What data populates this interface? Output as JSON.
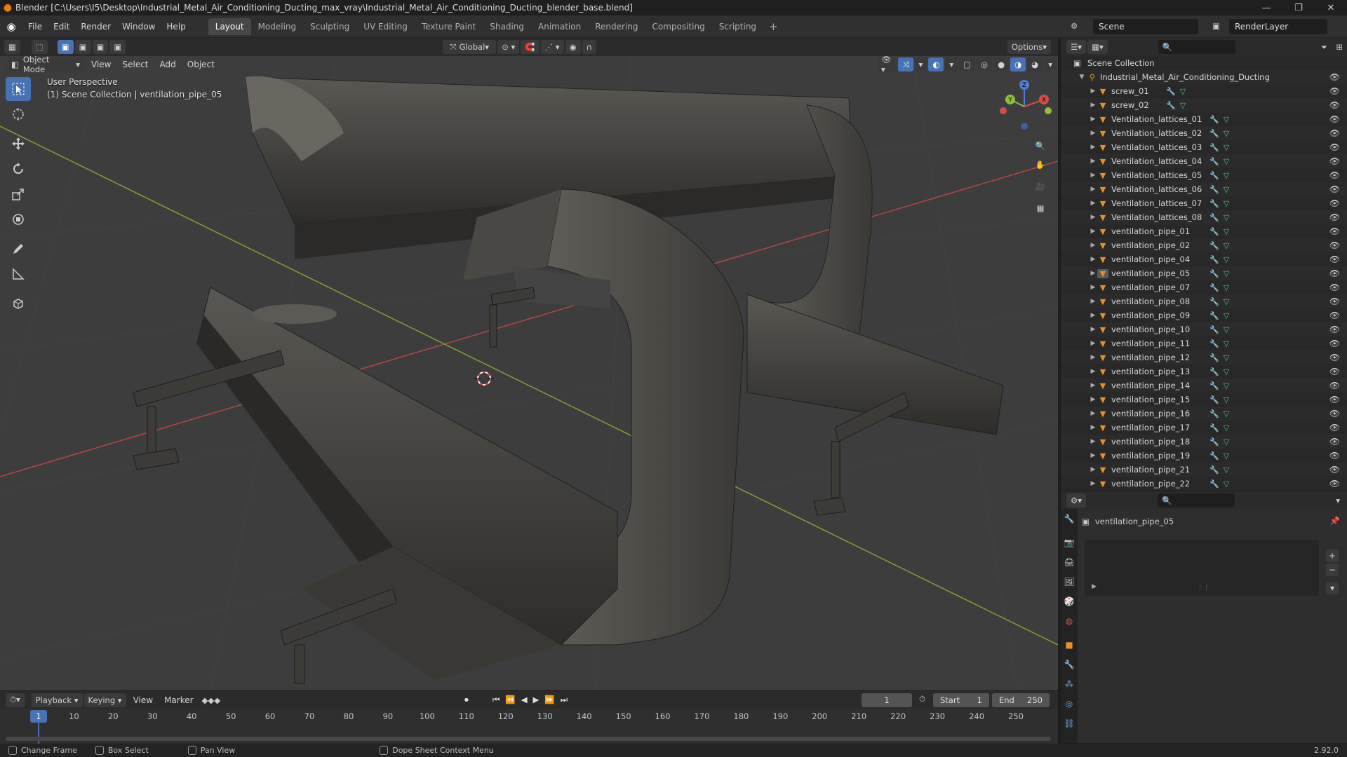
{
  "window": {
    "title": "Blender [C:\\Users\\I5\\Desktop\\Industrial_Metal_Air_Conditioning_Ducting_max_vray\\Industrial_Metal_Air_Conditioning_Ducting_blender_base.blend]"
  },
  "menubar": {
    "menus": [
      "File",
      "Edit",
      "Render",
      "Window",
      "Help"
    ],
    "workspaces": [
      "Layout",
      "Modeling",
      "Sculpting",
      "UV Editing",
      "Texture Paint",
      "Shading",
      "Animation",
      "Rendering",
      "Compositing",
      "Scripting"
    ],
    "active_workspace": "Layout",
    "scene": "Scene",
    "view_layer": "RenderLayer"
  },
  "viewport": {
    "mode": "Object Mode",
    "menus": [
      "View",
      "Select",
      "Add",
      "Object"
    ],
    "orientation": "Global",
    "options": "Options",
    "perspective_label": "User Perspective",
    "collection_label": "(1) Scene Collection | ventilation_pipe_05"
  },
  "outliner": {
    "root": "Scene Collection",
    "collection": "Industrial_Metal_Air_Conditioning_Ducting",
    "objects": [
      "screw_01",
      "screw_02",
      "Ventilation_lattices_01",
      "Ventilation_lattices_02",
      "Ventilation_lattices_03",
      "Ventilation_lattices_04",
      "Ventilation_lattices_05",
      "Ventilation_lattices_06",
      "Ventilation_lattices_07",
      "Ventilation_lattices_08",
      "ventilation_pipe_01",
      "ventilation_pipe_02",
      "ventilation_pipe_04",
      "ventilation_pipe_05",
      "ventilation_pipe_07",
      "ventilation_pipe_08",
      "ventilation_pipe_09",
      "ventilation_pipe_10",
      "ventilation_pipe_11",
      "ventilation_pipe_12",
      "ventilation_pipe_13",
      "ventilation_pipe_14",
      "ventilation_pipe_15",
      "ventilation_pipe_16",
      "ventilation_pipe_17",
      "ventilation_pipe_18",
      "ventilation_pipe_19",
      "ventilation_pipe_21",
      "ventilation_pipe_22"
    ],
    "selected": "ventilation_pipe_05"
  },
  "properties": {
    "object_name": "ventilation_pipe_05"
  },
  "timeline": {
    "menus": [
      "Playback",
      "Keying",
      "View",
      "Marker"
    ],
    "current_frame": "1",
    "start_label": "Start",
    "start": "1",
    "end_label": "End",
    "end": "250",
    "ticks": [
      "10",
      "20",
      "30",
      "40",
      "50",
      "60",
      "70",
      "80",
      "90",
      "100",
      "110",
      "120",
      "130",
      "140",
      "150",
      "160",
      "170",
      "180",
      "190",
      "200",
      "210",
      "220",
      "230",
      "240",
      "250"
    ]
  },
  "statusbar": {
    "items": [
      "Change Frame",
      "Box Select",
      "Pan View",
      "Dope Sheet Context Menu"
    ],
    "version": "2.92.0"
  },
  "colors": {
    "accent": "#4772b3",
    "object_orange": "#e8912b",
    "mesh_green": "#42c48e",
    "modifier_blue": "#6ea6e0",
    "axis_x": "#d94b4b",
    "axis_y": "#8fbf3a"
  }
}
